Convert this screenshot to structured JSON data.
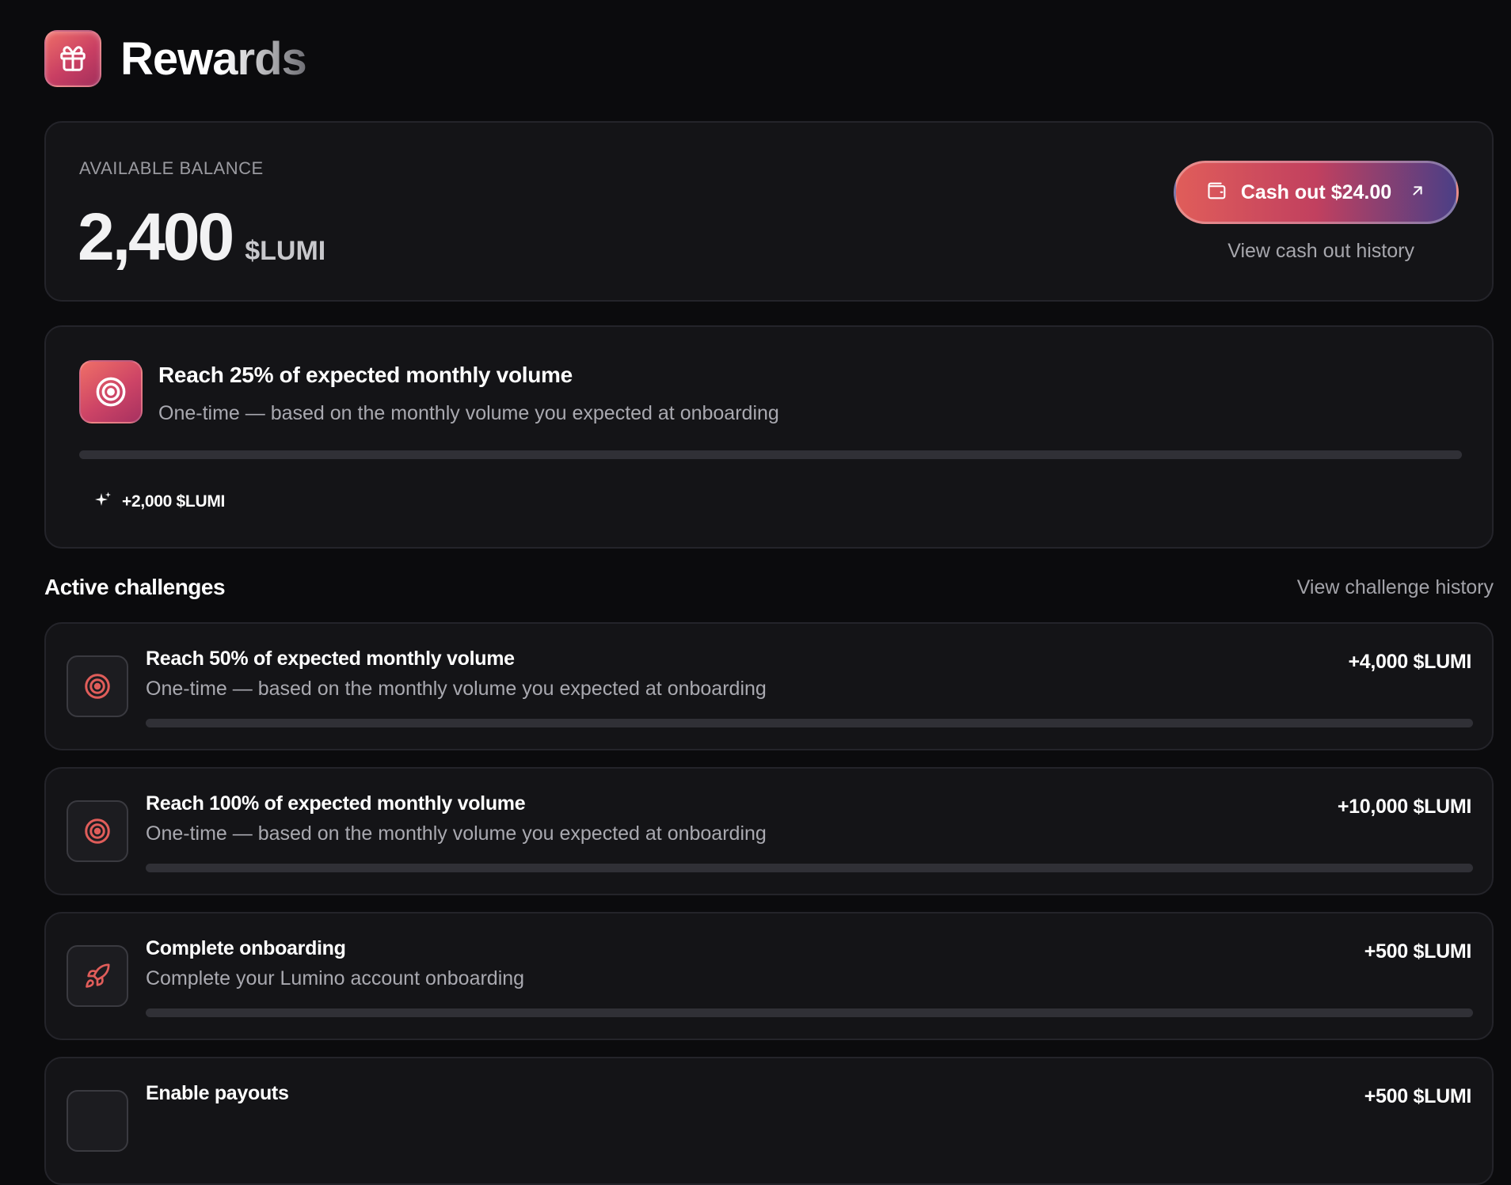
{
  "header": {
    "title": "Rewards",
    "icon": "gift-icon"
  },
  "balance": {
    "label": "AVAILABLE BALANCE",
    "value": "2,400",
    "unit": "$LUMI",
    "cashout_label": "Cash out $24.00",
    "cashout_icon": "wallet-icon",
    "cashout_arrow_icon": "arrow-up-right-icon",
    "history_link": "View cash out history"
  },
  "featured": {
    "icon": "target-icon",
    "title": "Reach 25% of expected monthly volume",
    "description": "One-time — based on the monthly volume you expected at onboarding",
    "progress": 0,
    "reward_icon": "sparkle-icon",
    "reward": "+2,000 $LUMI"
  },
  "active": {
    "title": "Active challenges",
    "history_link": "View challenge history",
    "items": [
      {
        "icon": "target-icon",
        "title": "Reach 50% of expected monthly volume",
        "description": "One-time — based on the monthly volume you expected at onboarding",
        "reward": "+4,000 $LUMI",
        "progress": 0
      },
      {
        "icon": "target-icon",
        "title": "Reach 100% of expected monthly volume",
        "description": "One-time — based on the monthly volume you expected at onboarding",
        "reward": "+10,000 $LUMI",
        "progress": 0
      },
      {
        "icon": "rocket-icon",
        "title": "Complete onboarding",
        "description": "Complete your Lumino account onboarding",
        "reward": "+500 $LUMI",
        "progress": 0
      },
      {
        "icon": "payout-icon",
        "title": "Enable payouts",
        "description": "",
        "reward": "+500 $LUMI",
        "progress": 0
      }
    ]
  },
  "colors": {
    "background": "#0b0b0d",
    "card": "#141417",
    "accent": "#e05d5a",
    "accent_pink": "#c93f63",
    "accent_violet": "#4b3f86",
    "muted_text": "#a9a9b0",
    "progress_track": "#303036"
  }
}
